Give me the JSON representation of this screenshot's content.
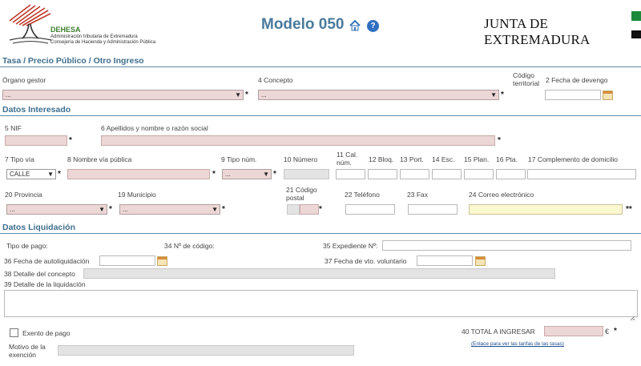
{
  "header": {
    "logo_name": "DEHESA",
    "logo_line1": "Administración tributaria de Extremadura",
    "logo_line2": "Consejería de Hacienda y Administración Pública",
    "title": "Modelo 050",
    "junta": "JUNTA DE EXTREMADURA"
  },
  "sections": {
    "tasa": "Tasa / Precio Público / Otro Ingreso",
    "interesado": "Datos Interesado",
    "liquidacion": "Datos Liquidación"
  },
  "tasa": {
    "organo_label": "Órgano gestor",
    "organo_value": "...",
    "concepto_label": "4 Concepto",
    "concepto_value": "...",
    "codigo_label": "Código territorial",
    "fecha_label": "2 Fecha de devengo"
  },
  "interesado": {
    "nif_label": "5 NIF",
    "nombre_label": "6 Apellidos y nombre o razón social",
    "tipo_via_label": "7 Tipo vía",
    "tipo_via_value": "CALLE",
    "nombre_via_label": "8 Nombre vía pública",
    "tipo_num_label": "9 Tipo núm.",
    "tipo_num_value": "...",
    "numero_label": "10 Número",
    "cal_label": "11 Cal. núm.",
    "bloq_label": "12 Bloq.",
    "port_label": "13 Port.",
    "esc_label": "14 Esc.",
    "plan_label": "15 Plan.",
    "pta_label": "16 Pta.",
    "complemento_label": "17 Complemento de domicilio",
    "provincia_label": "20 Provincia",
    "provincia_value": "...",
    "municipio_label": "19 Municipio",
    "municipio_value": "...",
    "cp_label": "21 Código postal",
    "telefono_label": "22 Teléfono",
    "fax_label": "23 Fax",
    "correo_label": "24 Correo electrónico"
  },
  "liquidacion": {
    "tipo_pago_label": "Tipo de pago:",
    "codigo_label": "34 Nº de código:",
    "expediente_label": "35 Expediente Nº:",
    "fecha_auto_label": "36 Fecha de autoliquidación",
    "fecha_vto_label": "37 Fecha de vto. voluntario",
    "detalle_concepto_label": "38 Detalle del concepto",
    "detalle_liq_label": "39 Detalle de la liquidación",
    "exento_label": "Exento de pago",
    "motivo_label": "Motivo de la exención",
    "total_label": "40 TOTAL A INGRESAR",
    "currency": "€",
    "enlace": "(Enlace para ver las tarifas de las tasas)"
  },
  "req_mark": "*",
  "req_mark_double": "**",
  "chev": "▼",
  "colors": {
    "accent": "#3f6f8f",
    "required_bg": "#ecd6d6",
    "disabled_bg": "#e3e3e3",
    "email_bg": "#fbf7cf"
  }
}
